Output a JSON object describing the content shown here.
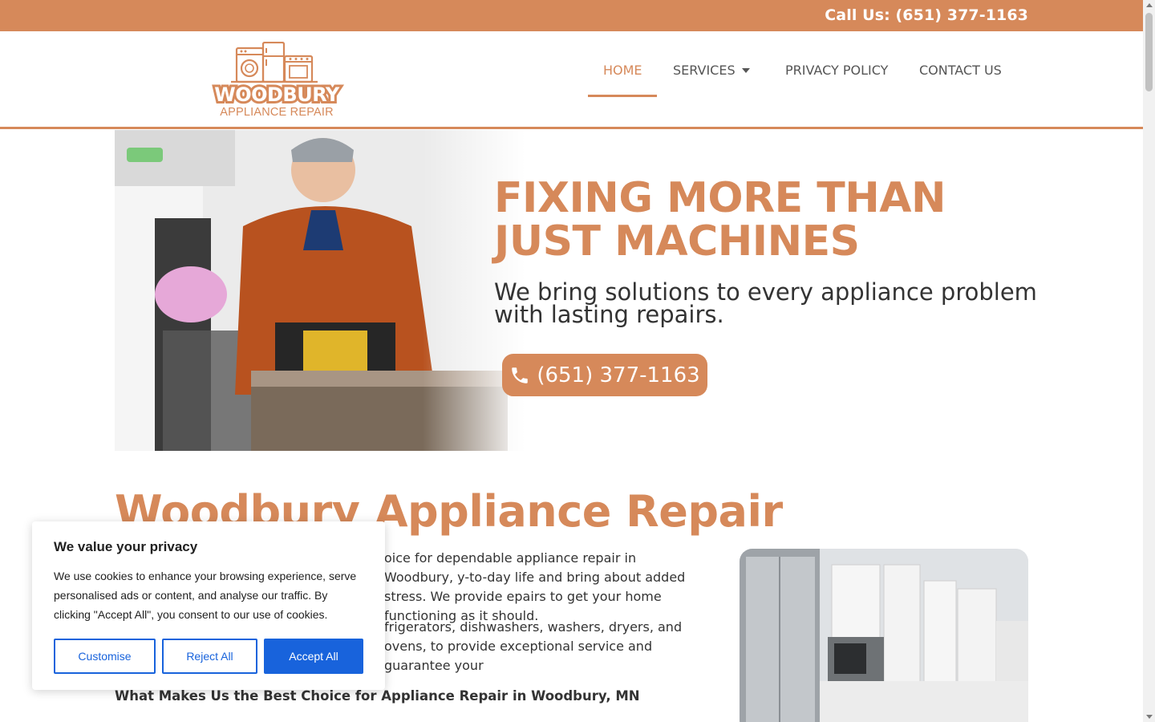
{
  "topbar": {
    "call_text": "Call Us: (651) 377-1163"
  },
  "logo": {
    "brand": "WOODBURY",
    "tagline": "APPLIANCE REPAIR"
  },
  "nav": {
    "items": [
      {
        "label": "HOME",
        "active": true
      },
      {
        "label": "SERVICES",
        "has_dropdown": true
      },
      {
        "label": "PRIVACY POLICY"
      },
      {
        "label": "CONTACT US"
      }
    ]
  },
  "hero": {
    "title_line1": "FIXING MORE THAN",
    "title_line2": "JUST MACHINES",
    "subtitle": "We bring solutions to every appliance problem with lasting repairs.",
    "phone_button": "(651) 377-1163"
  },
  "section": {
    "title": "Woodbury Appliance Repair",
    "p1": "oice for dependable appliance repair in Woodbury, y-to-day life and bring about added stress. We provide epairs to get your home functioning as it should.",
    "p2": "frigerators, dishwashers, washers, dryers, and ovens, to provide exceptional service and guarantee your",
    "subheading": "What Makes Us the Best Choice for Appliance Repair in Woodbury, MN"
  },
  "cookie": {
    "title": "We value your privacy",
    "body": "We use cookies to enhance your browsing experience, serve personalised ads or content, and analyse our traffic. By clicking \"Accept All\", you consent to our use of cookies.",
    "customise": "Customise",
    "reject": "Reject All",
    "accept": "Accept All"
  },
  "colors": {
    "accent": "#d6895a",
    "cookie_blue": "#1863dc"
  }
}
